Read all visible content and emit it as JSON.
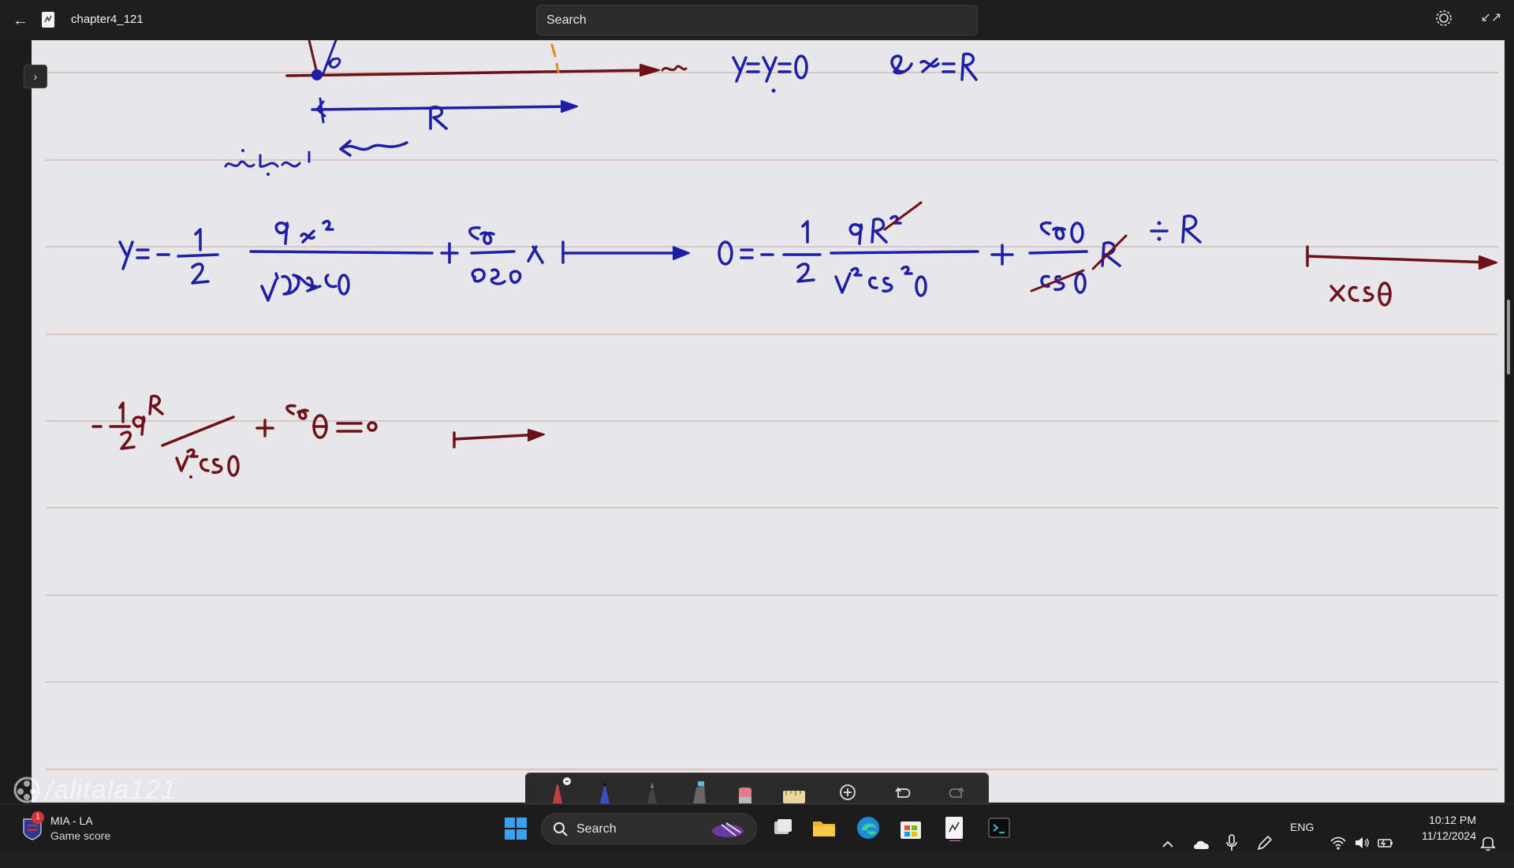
{
  "titlebar": {
    "document_title": "chapter4_121",
    "search_placeholder": "Search",
    "back_icon": "arrow-left-icon",
    "settings_icon": "gear-icon",
    "collapse_icon": "collapse-arrows-icon"
  },
  "canvas": {
    "expand_icon": "chevron-right-icon",
    "background_color": "#e7e7ea",
    "rule_color": "#d9c7c3",
    "ink_colors": {
      "blue": "#1e1ea6",
      "maroon": "#6e1018",
      "orange": "#e08a1a"
    }
  },
  "watermark": {
    "text": "/alitala121",
    "icon": "camera-reel-icon"
  },
  "pen_toolbar": {
    "tools": [
      "pen-red-icon",
      "pen-blue-icon",
      "pen-black-icon",
      "highlighter-icon",
      "eraser-icon",
      "ruler-icon",
      "add-tool-icon",
      "undo-icon",
      "redo-icon"
    ]
  },
  "taskbar": {
    "widget": {
      "title": "MIA - LA",
      "subtitle": "Game score",
      "badge": "1"
    },
    "search_label": "Search",
    "apps": [
      "task-view-icon",
      "file-explorer-icon",
      "edge-icon",
      "store-icon",
      "journal-icon",
      "terminal-icon"
    ],
    "tray": {
      "language": "ENG",
      "icons": [
        "chevron-up-icon",
        "cloud-icon",
        "microphone-icon",
        "pen-icon",
        "wifi-icon",
        "speaker-icon",
        "battery-icon",
        "notification-icon"
      ]
    },
    "time": "10:12 PM",
    "date": "11/12/2024"
  }
}
